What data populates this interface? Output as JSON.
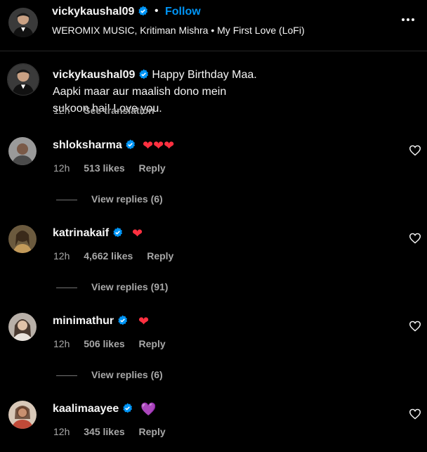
{
  "header": {
    "username": "vickykaushal09",
    "separator": "•",
    "follow_label": "Follow",
    "audio_line": "WEROMIX MUSIC, Kritiman Mishra • My First Love (LoFi)"
  },
  "caption": {
    "username": "vickykaushal09",
    "text": "Happy Birthday Maa. Aapki maar aur maalish dono mein sukoon hai! Love you.",
    "time": "12h",
    "see_translation": "See translation"
  },
  "comments": [
    {
      "username": "shloksharma",
      "text": "❤❤❤",
      "time": "12h",
      "likes": "513 likes",
      "reply": "Reply",
      "view_replies": "View replies (6)"
    },
    {
      "username": "katrinakaif",
      "text": "❤",
      "time": "12h",
      "likes": "4,662 likes",
      "reply": "Reply",
      "view_replies": "View replies (91)"
    },
    {
      "username": "minimathur",
      "text": "❤",
      "time": "12h",
      "likes": "506 likes",
      "reply": "Reply",
      "view_replies": "View replies (6)"
    },
    {
      "username": "kaalimaayee",
      "text": "💜",
      "time": "12h",
      "likes": "345 likes",
      "reply": "Reply"
    }
  ],
  "colors": {
    "link_blue": "#0095f6",
    "verified_blue": "#0095f6",
    "heart_red": "#ff3040",
    "heart_purple": "#8b5cf6",
    "muted": "#a8a8a8"
  }
}
